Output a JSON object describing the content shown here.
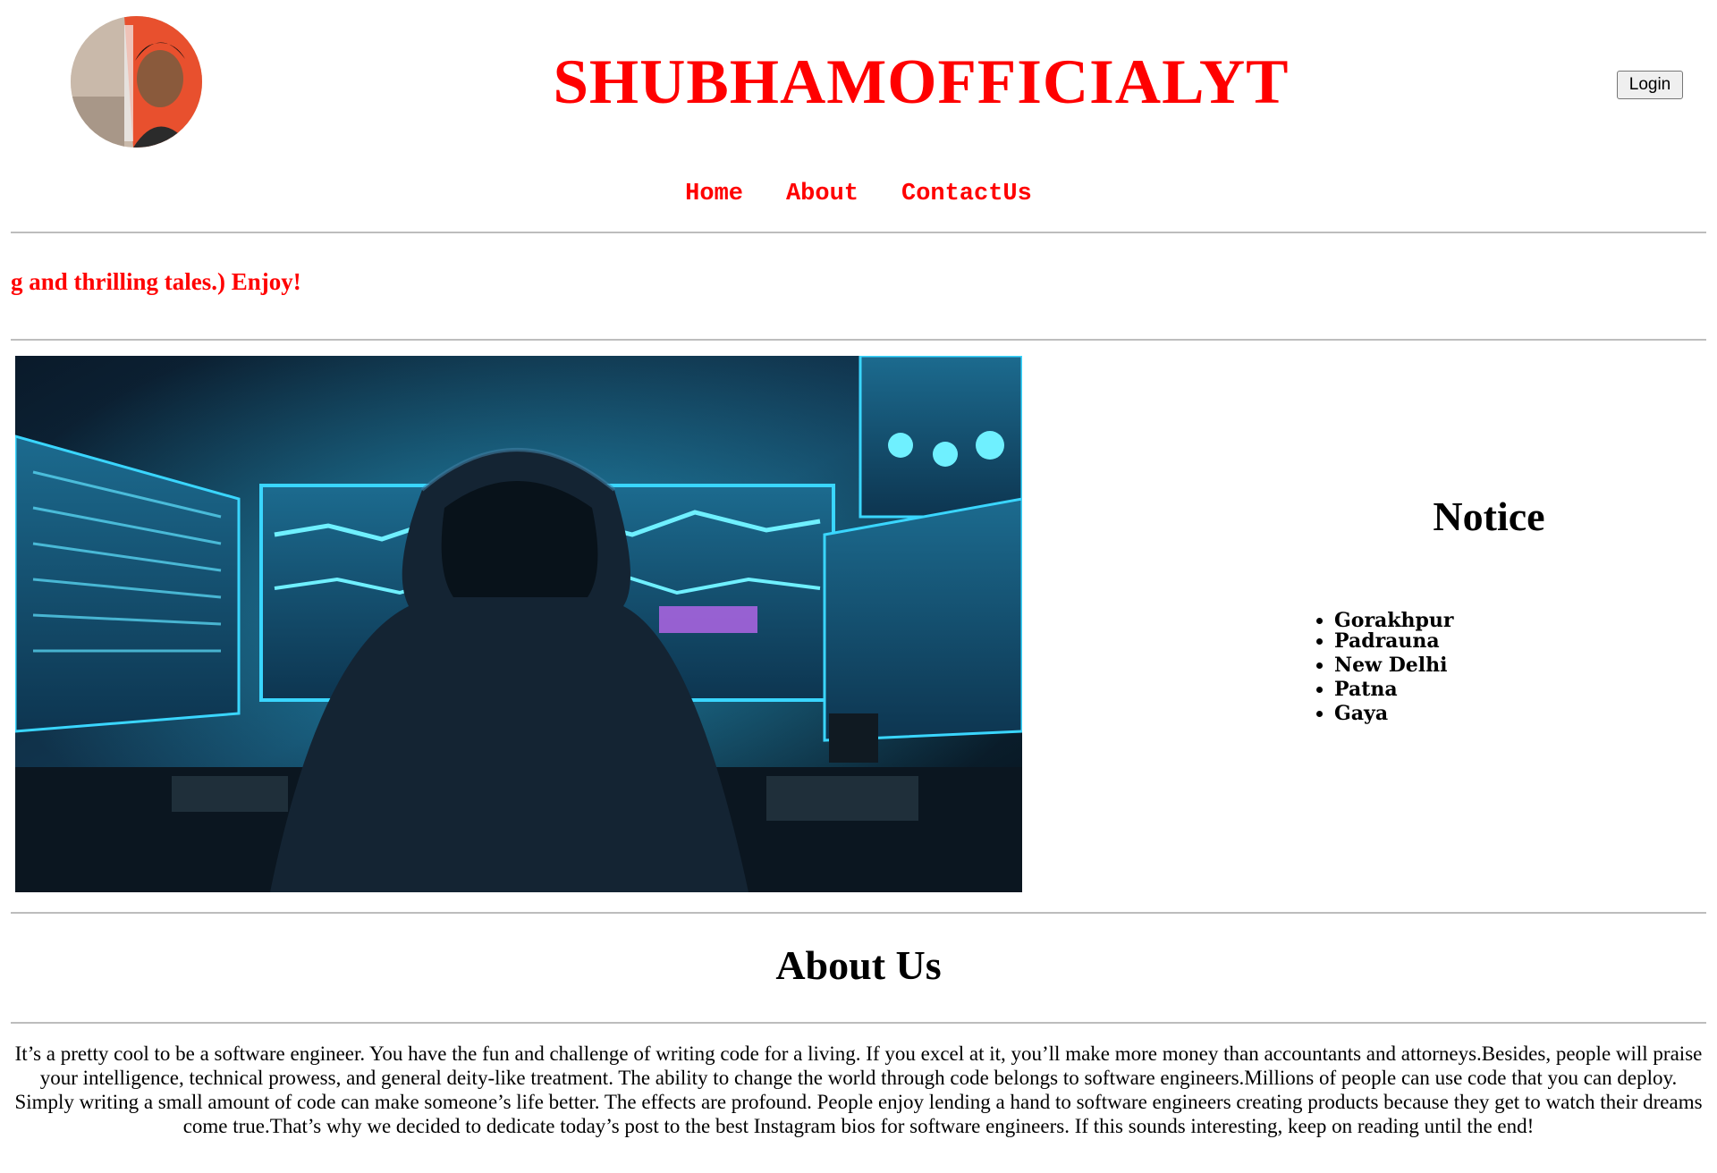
{
  "header": {
    "site_title": "SHUBHAMOFFICIALYT",
    "login_label": "Login"
  },
  "nav": {
    "items": [
      {
        "label": "Home"
      },
      {
        "label": "About"
      },
      {
        "label": "ContactUs"
      }
    ]
  },
  "marquee": {
    "text": "g and thrilling tales.) Enjoy!"
  },
  "notice": {
    "title": "Notice",
    "items": [
      "Gorakhpur",
      "Padrauna",
      "New Delhi",
      "Patna",
      "Gaya"
    ]
  },
  "about": {
    "title": "About Us",
    "body": "It’s a pretty cool to be a software engineer. You have the fun and challenge of writing code for a living. If you excel at it, you’ll make more money than accountants and attorneys.Besides, people will praise your intelligence, technical prowess, and general deity-like treatment. The ability to change the world through code belongs to software engineers.Millions of people can use code that you can deploy. Simply writing a small amount of code can make someone’s life better. The effects are profound. People enjoy lending a hand to software engineers creating products because they get to watch their dreams come true.That’s why we decided to dedicate today’s post to the best Instagram bios for software engineers. If this sounds interesting, keep on reading until the end!"
  },
  "colors": {
    "accent": "#ff0000",
    "rule": "#bdbdbd",
    "hero_glow": "#29c8ff"
  }
}
